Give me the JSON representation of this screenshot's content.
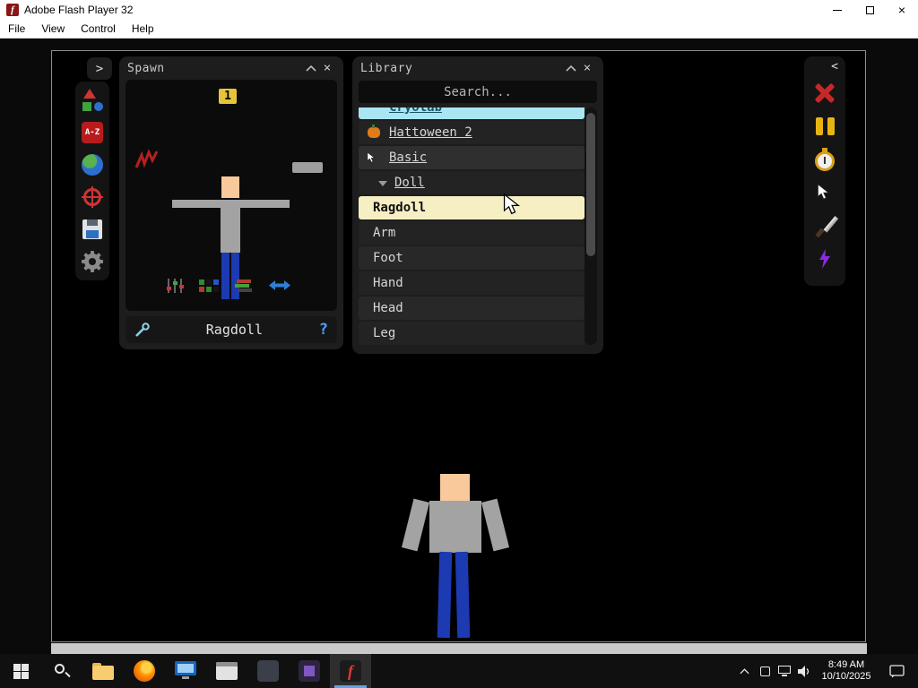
{
  "titlebar": {
    "icon_letter": "f",
    "title": "Adobe Flash Player 32"
  },
  "menubar": {
    "items": [
      "File",
      "View",
      "Control",
      "Help"
    ]
  },
  "glyphs": {
    "close": "×",
    "expand_right": ">",
    "collapse_left": "<",
    "help": "?"
  },
  "spawn_panel": {
    "title": "Spawn",
    "count_badge": "1",
    "selected_name": "Ragdoll"
  },
  "library_panel": {
    "title": "Library",
    "search_placeholder": "Search...",
    "items": [
      {
        "label": "Cryolab"
      },
      {
        "label": "Hattoween 2"
      },
      {
        "label": "Basic"
      },
      {
        "label": "Doll"
      },
      {
        "label": "Ragdoll"
      },
      {
        "label": "Arm"
      },
      {
        "label": "Foot"
      },
      {
        "label": "Hand"
      },
      {
        "label": "Head"
      },
      {
        "label": "Leg"
      }
    ]
  },
  "left_toolbar": {
    "az_label": "A-Z",
    "icons": [
      "spawn-shapes",
      "sort-az",
      "world",
      "target",
      "save",
      "settings-gear"
    ]
  },
  "right_toolbar": {
    "icons": [
      "delete-x",
      "pause",
      "stopwatch",
      "cursor",
      "knife",
      "lightning"
    ]
  },
  "taskbar": {
    "time": "8:49 AM",
    "date": "10/10/2025"
  },
  "colors": {
    "selected_row": "#f6efc3",
    "category_highlight": "#a9e6f2",
    "accent_blue": "#4da3ff",
    "badge_yellow": "#e7c33b",
    "active_app_underline": "#5ea3e6"
  }
}
